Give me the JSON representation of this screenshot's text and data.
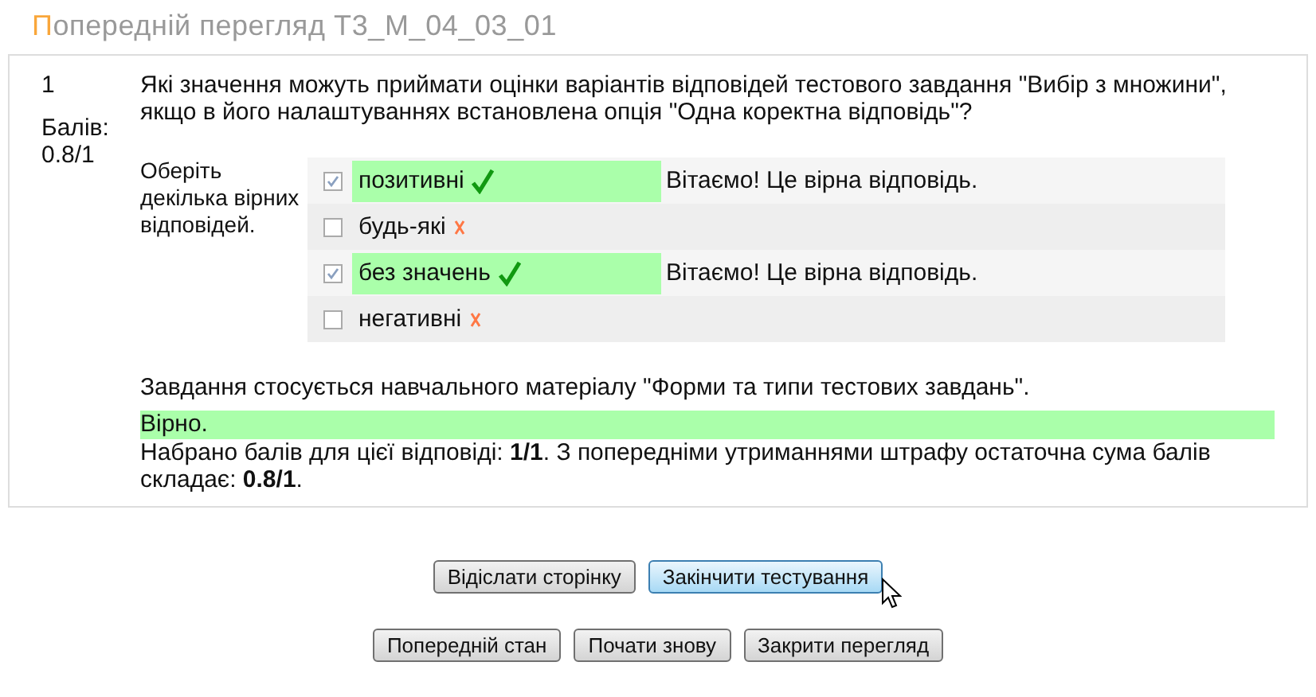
{
  "title": "Попередній перегляд Т3_М_04_03_01",
  "question": {
    "number": "1",
    "grade_label": "Балів:",
    "grade": "0.8/1",
    "text": "Які значення можуть приймати оцінки варіантів відповідей тестового завдання \"Вибір з множини\", якщо в його налаштуваннях встановлена опція \"Одна коректна відповідь\"?",
    "prompt": "Оберіть декілька вірних відповідей.",
    "options": [
      {
        "label": "позитивні",
        "checked": true,
        "correct": true,
        "feedback": "Вітаємо! Це вірна відповідь."
      },
      {
        "label": "будь-які",
        "checked": false,
        "correct": false
      },
      {
        "label": "без значень",
        "checked": true,
        "correct": true,
        "feedback": "Вітаємо! Це вірна відповідь."
      },
      {
        "label": "негативні",
        "checked": false,
        "correct": false
      }
    ],
    "general_feedback": "Завдання стосується навчального матеріалу \"Форми та типи тестових завдань\".",
    "result": "Вірно.",
    "grading": "Набрано балів для цієї відповіді: **1/1**. З попередніми утриманнями штрафу остаточна сума балів складає: **0.8/1**."
  },
  "button_rows": [
    [
      {
        "label": "Відіслати сторінку",
        "highlighted": false
      },
      {
        "label": "Закінчити тестування",
        "highlighted": true
      }
    ],
    [
      {
        "label": "Попередній стан",
        "highlighted": false
      },
      {
        "label": "Почати знову",
        "highlighted": false
      },
      {
        "label": "Закрити перегляд",
        "highlighted": false
      }
    ]
  ]
}
